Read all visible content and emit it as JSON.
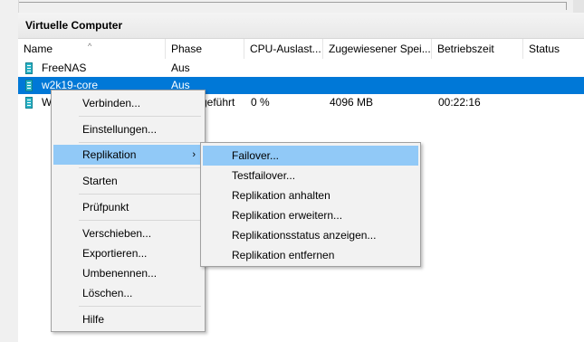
{
  "panel": {
    "title": "Virtuelle Computer"
  },
  "table": {
    "columns": [
      "Name",
      "Phase",
      "CPU-Auslast...",
      "Zugewiesener Spei...",
      "Betriebszeit",
      "Status"
    ],
    "rows": [
      {
        "name": "FreeNAS",
        "phase": "Aus",
        "cpu": "",
        "memory": "",
        "uptime": "",
        "status": ""
      },
      {
        "name": "w2k19-core",
        "phase": "Aus",
        "cpu": "",
        "memory": "",
        "uptime": "",
        "status": ""
      },
      {
        "name": "W",
        "phase": "sgeführt",
        "cpu": "0 %",
        "memory": "4096 MB",
        "uptime": "00:22:16",
        "status": ""
      }
    ]
  },
  "context_menu": {
    "items": [
      "Verbinden...",
      "Einstellungen...",
      "Replikation",
      "Starten",
      "Prüfpunkt",
      "Verschieben...",
      "Exportieren...",
      "Umbenennen...",
      "Löschen...",
      "Hilfe"
    ],
    "submenu_arrow": "›"
  },
  "submenu": {
    "items": [
      "Failover...",
      "Testfailover...",
      "Replikation anhalten",
      "Replikation erweitern...",
      "Replikationsstatus anzeigen...",
      "Replikation entfernen"
    ]
  },
  "colors": {
    "selection": "#0078d7",
    "menu_highlight": "#91c9f7",
    "vm_icon": "#2bb5c8"
  },
  "icons": {
    "vm": "virtual-machine-icon",
    "sort": "sort-ascending-icon"
  }
}
